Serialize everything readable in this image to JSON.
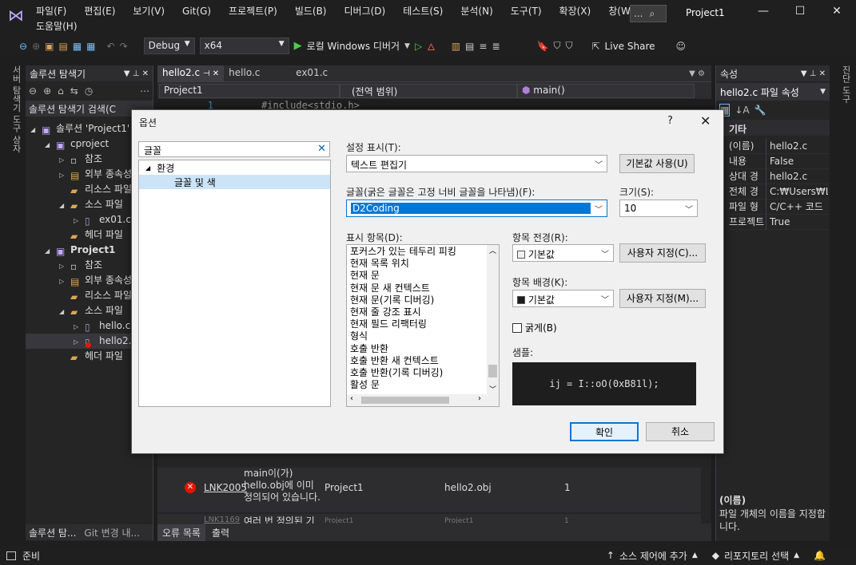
{
  "menu": {
    "items": [
      "파일(F)",
      "편집(E)",
      "보기(V)",
      "Git(G)",
      "프로젝트(P)",
      "빌드(B)",
      "디버그(D)",
      "테스트(S)",
      "분석(N)",
      "도구(T)",
      "확장(X)",
      "창(W)"
    ],
    "help": "도움말(H)",
    "search": "..."
  },
  "window": {
    "title": "Project1"
  },
  "toolbar": {
    "config": "Debug",
    "platform": "x64",
    "run_label": "로컬 Windows 디버거",
    "live_share": "Live Share"
  },
  "left_strip": "서버 탐색기 도구 상자",
  "right_strip": "진단 도구",
  "solution_explorer": {
    "title": "솔루션 탐색기",
    "search": "솔루션 탐색기 검색(C",
    "items": [
      {
        "label": "솔루션 'Project1'",
        "indent": 0,
        "icon": "solution-icon"
      },
      {
        "label": "cproject",
        "indent": 1,
        "icon": "project-icon"
      },
      {
        "label": "참조",
        "indent": 2,
        "icon": "references-icon"
      },
      {
        "label": "외부 종속성",
        "indent": 2,
        "icon": "external-deps-icon"
      },
      {
        "label": "리소스 파일",
        "indent": 2,
        "icon": "folder-icon"
      },
      {
        "label": "소스 파일",
        "indent": 2,
        "icon": "folder-icon"
      },
      {
        "label": "ex01.c",
        "indent": 3,
        "icon": "c-file-icon"
      },
      {
        "label": "헤더 파일",
        "indent": 2,
        "icon": "folder-icon"
      },
      {
        "label": "Project1",
        "indent": 1,
        "icon": "project-icon"
      },
      {
        "label": "참조",
        "indent": 2,
        "icon": "references-icon"
      },
      {
        "label": "외부 종속성",
        "indent": 2,
        "icon": "external-deps-icon"
      },
      {
        "label": "리소스 파일",
        "indent": 2,
        "icon": "folder-icon"
      },
      {
        "label": "소스 파일",
        "indent": 2,
        "icon": "folder-icon"
      },
      {
        "label": "hello.c",
        "indent": 3,
        "icon": "c-file-icon"
      },
      {
        "label": "hello2.c",
        "indent": 3,
        "icon": "c-file-error-icon"
      },
      {
        "label": "헤더 파일",
        "indent": 2,
        "icon": "folder-icon"
      }
    ],
    "bottom_tabs": [
      "솔루션 탐...",
      "Git 변경 내..."
    ]
  },
  "editor": {
    "tabs": [
      "hello2.c",
      "hello.c",
      "ex01.c"
    ],
    "file_combo": "Project1",
    "scope_combo": "(전역 범위)",
    "member_combo": "main()",
    "line_number": "1",
    "code_line": "#include<stdio.h>"
  },
  "error_list": {
    "rows": [
      {
        "code": "LNK2005",
        "desc": "main이(가) hello.obj에 이미 정의되어 있습니다.",
        "project": "Project1",
        "file": "hello2.obj",
        "line": "1"
      },
      {
        "code": "LNK1169",
        "desc": "여러 번 정의된 기",
        "project": "Project1",
        "file": "Project1",
        "line": "1"
      }
    ],
    "tabs": [
      "오류 목록",
      "출력"
    ]
  },
  "properties": {
    "title": "속성",
    "object": "hello2.c 파일 속성",
    "category": "기타",
    "rows": [
      {
        "name": "(이름)",
        "value": "hello2.c"
      },
      {
        "name": "내용",
        "value": "False"
      },
      {
        "name": "상대 경",
        "value": "hello2.c"
      },
      {
        "name": "전체 경",
        "value": "C:₩Users₩LDH"
      },
      {
        "name": "파일 형",
        "value": "C/C++ 코드"
      },
      {
        "name": "프로젝트",
        "value": "True"
      }
    ],
    "desc_title": "(이름)",
    "desc_text": "파일 개체의 이름을 지정합니다."
  },
  "status": {
    "ready": "준비",
    "source_control": "소스 제어에 추가",
    "repo": "리포지토리 선택"
  },
  "dialog": {
    "title": "옵션",
    "help": "?",
    "search_value": "글꼴",
    "tree_parent": "환경",
    "tree_child": "글꼴 및 색",
    "show_settings_label": "설정 표시(T):",
    "show_settings_value": "텍스트 편집기",
    "use_defaults": "기본값 사용(U)",
    "font_label": "글꼴(굵은 글꼴은 고정 너비 글꼴을 나타냄)(F):",
    "font_value": "D2Coding",
    "size_label": "크기(S):",
    "size_value": "10",
    "items_label": "표시 항목(D):",
    "items": [
      "포커스가 있는 테두리 피킹",
      "현재 목록 위치",
      "현재 문",
      "현재 문 새 컨텍스트",
      "현재 문(기록 디버깅)",
      "현재 줄 강조 표시",
      "현재 필드 리팩터링",
      "형식",
      "호출 반환",
      "호출 반환 새 컨텍스트",
      "호출 반환(기록 디버깅)",
      "활성 문"
    ],
    "fg_label": "항목 전경(R):",
    "fg_value": "기본값",
    "bg_label": "항목 배경(K):",
    "bg_value": "기본값",
    "custom_fg": "사용자 지정(C)...",
    "custom_bg": "사용자 지정(M)...",
    "bold_label": "굵게(B)",
    "sample_label": "샘플:",
    "sample_text": "ij = I::oO(0xB81l);",
    "ok": "확인",
    "cancel": "취소"
  },
  "colors": {
    "accent": "#0078d7",
    "error": "#e51400",
    "background": "#1e1e1e"
  }
}
